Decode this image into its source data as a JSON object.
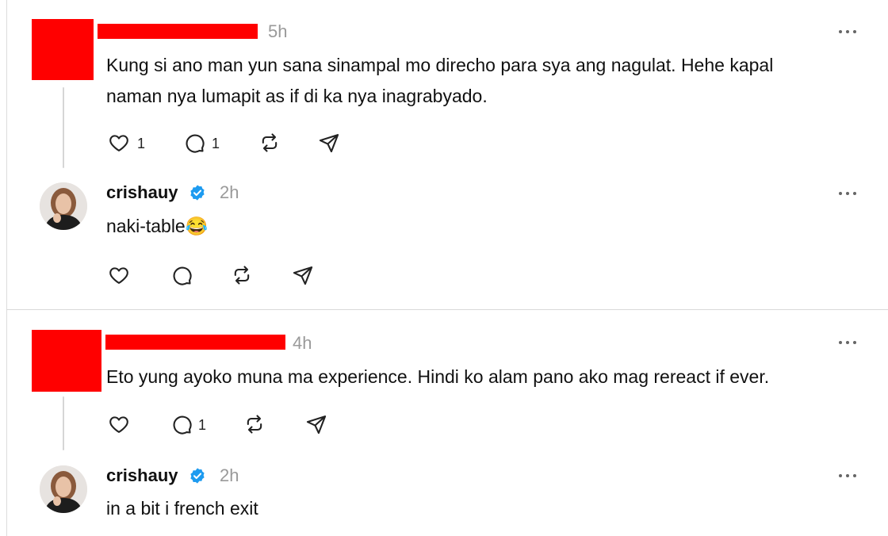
{
  "posts": [
    {
      "time": "5h",
      "text_lines": [
        "Kung si ano man yun sana sinampal mo direcho para sya ang nagulat. Hehe kapal",
        "naman nya lumapit as if di ka nya inagrabyado."
      ],
      "like_count": "1",
      "reply_count": "1",
      "reply": {
        "username": "crishauy",
        "time": "2h",
        "text": "naki-table😂"
      }
    },
    {
      "time": "4h",
      "text_lines": [
        "Eto yung ayoko muna ma experience. Hindi ko alam pano ako mag rereact if ever."
      ],
      "like_count": "",
      "reply_count": "1",
      "reply": {
        "username": "crishauy",
        "time": "2h",
        "text": "in a bit i french exit"
      }
    }
  ],
  "icons": {
    "like": "heart-icon",
    "reply": "comment-icon",
    "repost": "repost-icon",
    "share": "send-icon",
    "more": "more-icon",
    "verified": "verified-badge-icon"
  },
  "colors": {
    "verified": "#1d9bf0",
    "timestamp": "#9a9a9a",
    "redaction": "#ff0000"
  }
}
